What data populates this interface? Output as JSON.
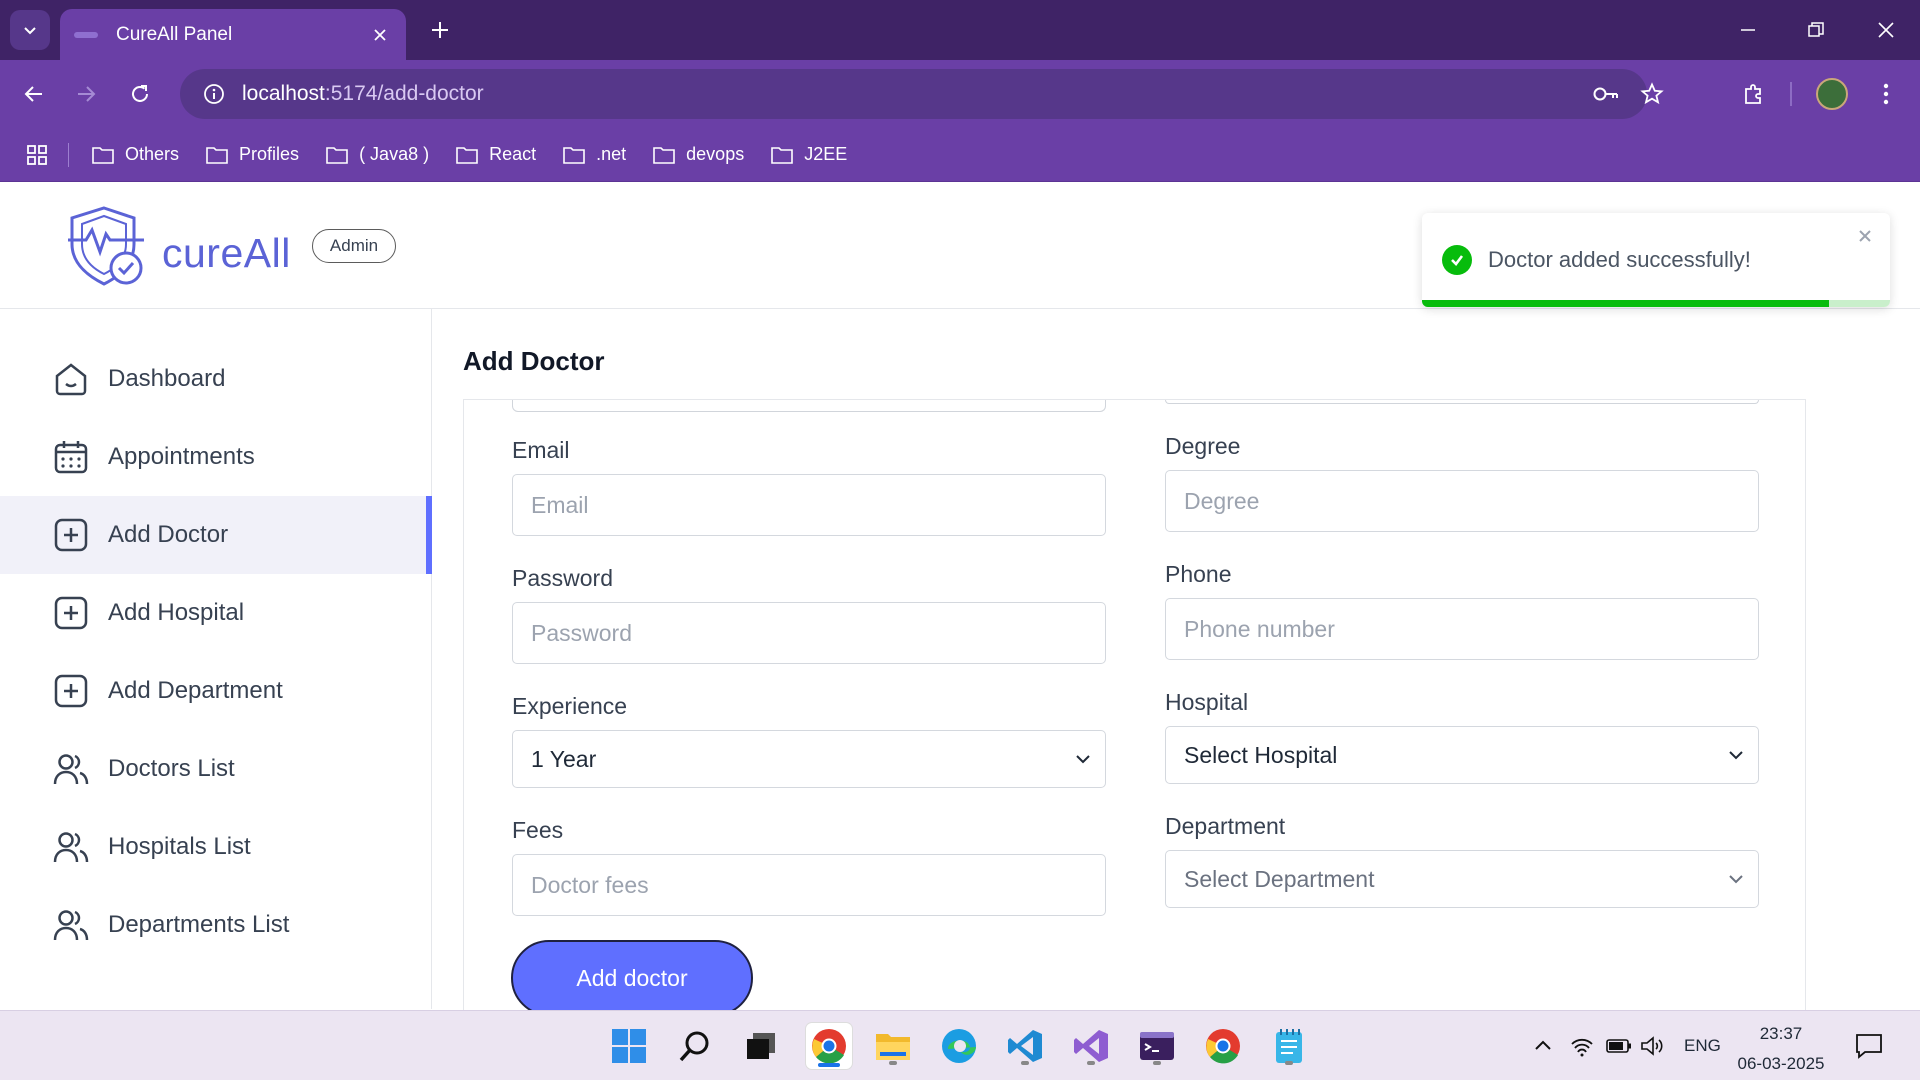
{
  "browser": {
    "tab_title": "CureAll Panel",
    "url_host": "localhost",
    "url_path": ":5174/add-doctor",
    "bookmarks": [
      "Others",
      "Profiles",
      "( Java8 )",
      "React",
      ".net",
      "devops",
      "J2EE"
    ]
  },
  "header": {
    "brand": "cureAll",
    "badge": "Admin"
  },
  "sidebar": {
    "items": [
      {
        "label": "Dashboard",
        "icon": "home-icon"
      },
      {
        "label": "Appointments",
        "icon": "calendar-icon"
      },
      {
        "label": "Add Doctor",
        "icon": "add-square-icon",
        "active": true
      },
      {
        "label": "Add Hospital",
        "icon": "add-square-icon"
      },
      {
        "label": "Add Department",
        "icon": "add-square-icon"
      },
      {
        "label": "Doctors List",
        "icon": "people-icon"
      },
      {
        "label": "Hospitals List",
        "icon": "people-icon"
      },
      {
        "label": "Departments List",
        "icon": "people-icon"
      }
    ]
  },
  "main": {
    "title": "Add Doctor",
    "form": {
      "email": {
        "label": "Email",
        "placeholder": "Email"
      },
      "password": {
        "label": "Password",
        "placeholder": "Password"
      },
      "experience": {
        "label": "Experience",
        "value": "1 Year"
      },
      "fees": {
        "label": "Fees",
        "placeholder": "Doctor fees"
      },
      "degree": {
        "label": "Degree",
        "placeholder": "Degree"
      },
      "phone": {
        "label": "Phone",
        "placeholder": "Phone number"
      },
      "hospital": {
        "label": "Hospital",
        "value": "Select Hospital"
      },
      "department": {
        "label": "Department",
        "value": "Select Department"
      },
      "submit": "Add doctor"
    }
  },
  "toast": {
    "message": "Doctor added successfully!",
    "progress": 0.87
  },
  "taskbar": {
    "language": "ENG",
    "time": "23:37",
    "date": "06-03-2025"
  },
  "colors": {
    "accent": "#5f6fff",
    "browser_frame": "#6a3fa6",
    "success": "#07bc0c"
  }
}
